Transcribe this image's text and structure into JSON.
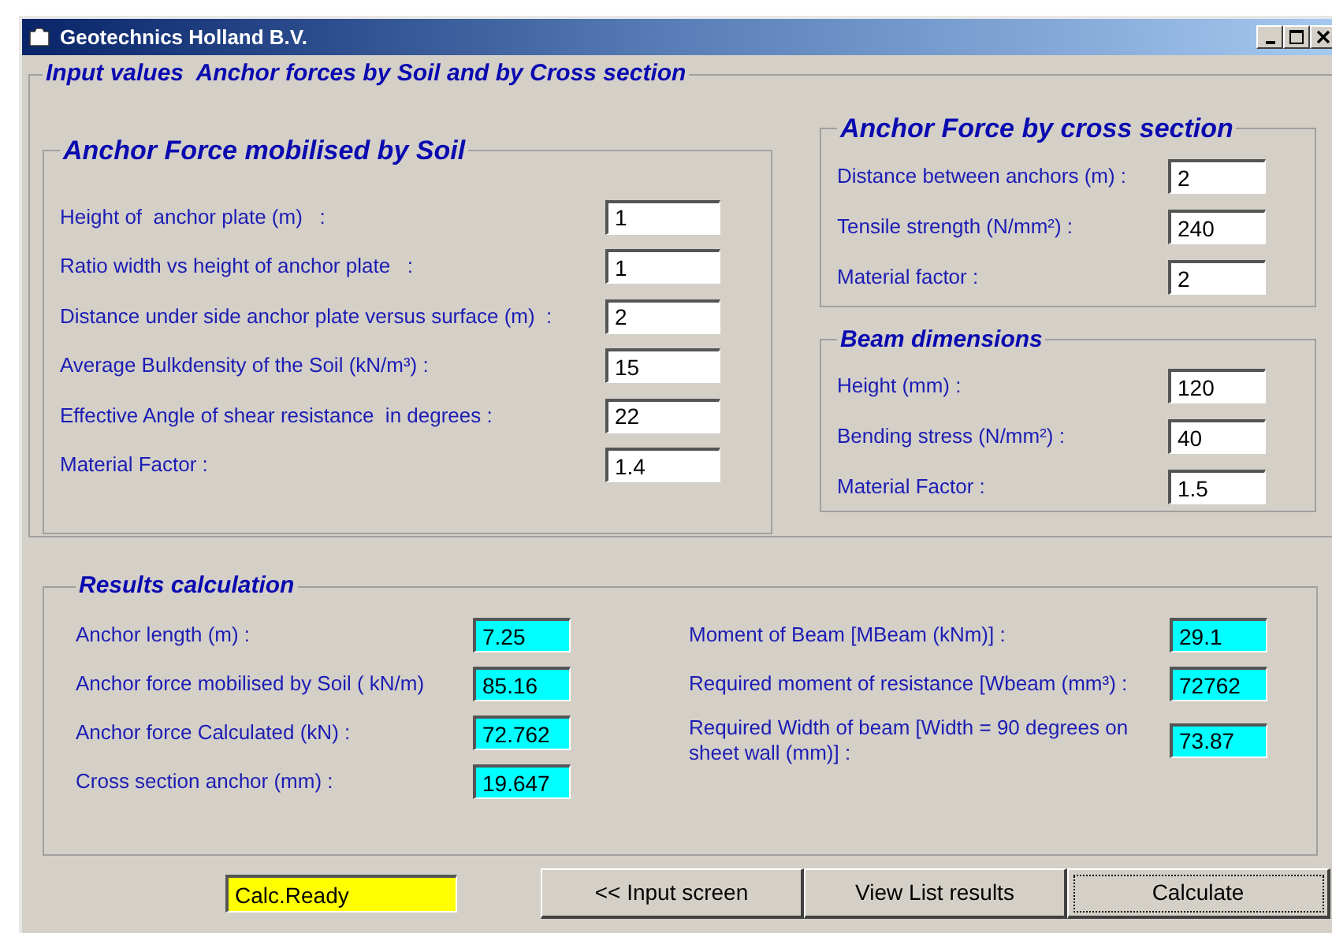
{
  "window": {
    "title": "Geotechnics Holland B.V."
  },
  "main_group": {
    "title": "Input values  Anchor forces by Soil and by Cross section"
  },
  "soil_group": {
    "title": "Anchor Force mobilised by Soil",
    "fields": [
      {
        "label": "Height of  anchor plate (m)   :",
        "value": "1"
      },
      {
        "label": "Ratio width vs height of anchor plate   :",
        "value": "1"
      },
      {
        "label": "Distance under side anchor plate versus surface (m)  :",
        "value": "2"
      },
      {
        "label": "Average Bulkdensity of the Soil (kN/m³) :",
        "value": "15"
      },
      {
        "label": "Effective Angle of shear resistance  in degrees :",
        "value": "22"
      },
      {
        "label": "Material Factor :",
        "value": "1.4"
      }
    ]
  },
  "cross_section_group": {
    "title": "Anchor Force by cross section",
    "fields": [
      {
        "label": "Distance between anchors (m) :",
        "value": "2"
      },
      {
        "label": "Tensile strength (N/mm²) :",
        "value": "240"
      },
      {
        "label": "Material factor :",
        "value": "2"
      }
    ]
  },
  "beam_group": {
    "title": "Beam dimensions",
    "fields": [
      {
        "label": "Height (mm) :",
        "value": "120"
      },
      {
        "label": "Bending stress (N/mm²) :",
        "value": "40"
      },
      {
        "label": "Material Factor :",
        "value": "1.5"
      }
    ]
  },
  "results": {
    "title": "Results calculation",
    "left": [
      {
        "label": "Anchor length (m) :",
        "value": "7.25"
      },
      {
        "label": "Anchor force mobilised by Soil ( kN/m)",
        "value": "85.16"
      },
      {
        "label": "Anchor force Calculated (kN) :",
        "value": "72.762"
      },
      {
        "label": "Cross section anchor (mm) :",
        "value": "19.647"
      }
    ],
    "right": [
      {
        "label": "Moment of Beam [MBeam (kNm)] :",
        "value": "29.1"
      },
      {
        "label": "Required moment of resistance [Wbeam (mm³) :",
        "value": "72762"
      },
      {
        "label": "Required Width of beam [Width = 90 degrees on sheet wall (mm)] :",
        "value": "73.87"
      }
    ]
  },
  "status_field": {
    "value": "Calc.Ready"
  },
  "buttons": [
    {
      "label": "<<  Input screen",
      "focused": false
    },
    {
      "label": "View List results",
      "focused": false
    },
    {
      "label": "Calculate",
      "focused": true
    }
  ]
}
